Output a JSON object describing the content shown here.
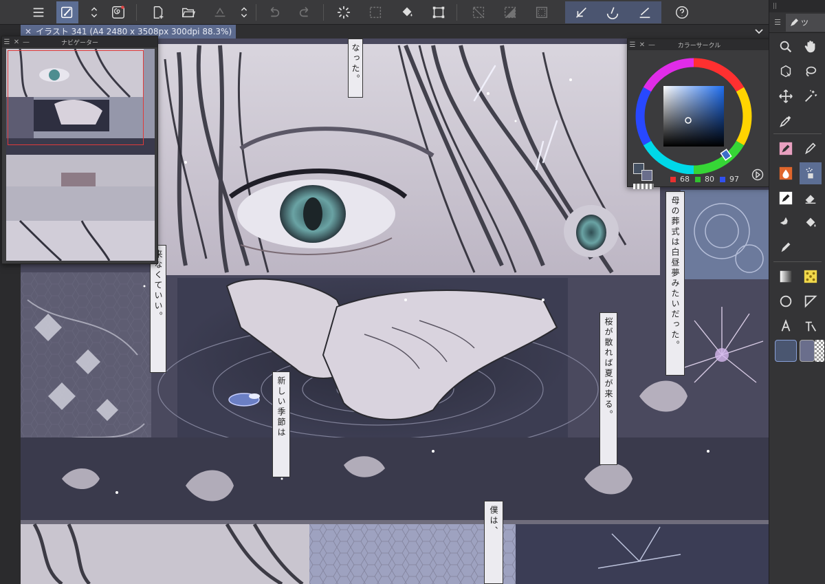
{
  "app": {
    "document_tab": {
      "label": "イラスト 341 (A4 2480 x 3508px 300dpi 88.3%)"
    }
  },
  "toolbar": {
    "buttons": [
      {
        "name": "menu-icon"
      },
      {
        "name": "brush-settings-icon"
      },
      {
        "name": "swap-arrows-icon"
      },
      {
        "name": "spiral-icon"
      },
      {
        "name": "new-file-icon"
      },
      {
        "name": "open-folder-icon"
      },
      {
        "name": "save-icon"
      },
      {
        "name": "undo-icon"
      },
      {
        "name": "redo-icon"
      },
      {
        "name": "loading-dots-icon"
      },
      {
        "name": "select-all-icon"
      },
      {
        "name": "fill-icon"
      },
      {
        "name": "transform-icon"
      },
      {
        "name": "clear-selection-icon"
      },
      {
        "name": "invert-selection-icon"
      },
      {
        "name": "selection-border-icon"
      },
      {
        "name": "ruler-snap-icon"
      },
      {
        "name": "special-ruler-snap-icon"
      },
      {
        "name": "grid-snap-icon"
      },
      {
        "name": "help-icon"
      }
    ]
  },
  "navigator": {
    "title": "ナビゲーター"
  },
  "color_circle": {
    "title": "カラーサークル",
    "values": {
      "r": "68",
      "g": "80",
      "b": "97"
    },
    "colors": {
      "main": "#445061",
      "sub": "#6a6e8c",
      "picker": "#3c6ec8"
    }
  },
  "canvas": {
    "captions": [
      "なった。",
      "来なくていい。",
      "新しい季節は",
      "桜が散れば夏が来る。",
      "母の葬式は白昼夢みたいだった。",
      "僕は、"
    ]
  },
  "right_panel": {
    "tab_label": "ツ"
  }
}
